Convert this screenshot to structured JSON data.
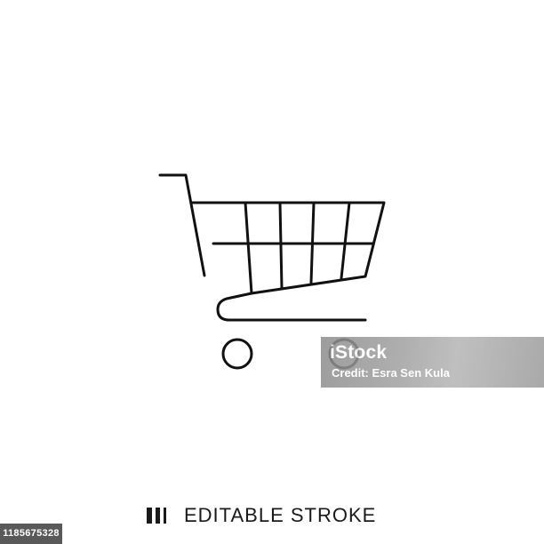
{
  "icon": {
    "name": "shopping-cart-icon",
    "stroke_color": "#111111"
  },
  "watermark": {
    "logo": "iStock",
    "credit": "Credit: Esra Sen Kula"
  },
  "stock_id": "1185675328",
  "footer": {
    "label": "EDITABLE STROKE",
    "icon": "editable-stroke-icon"
  }
}
